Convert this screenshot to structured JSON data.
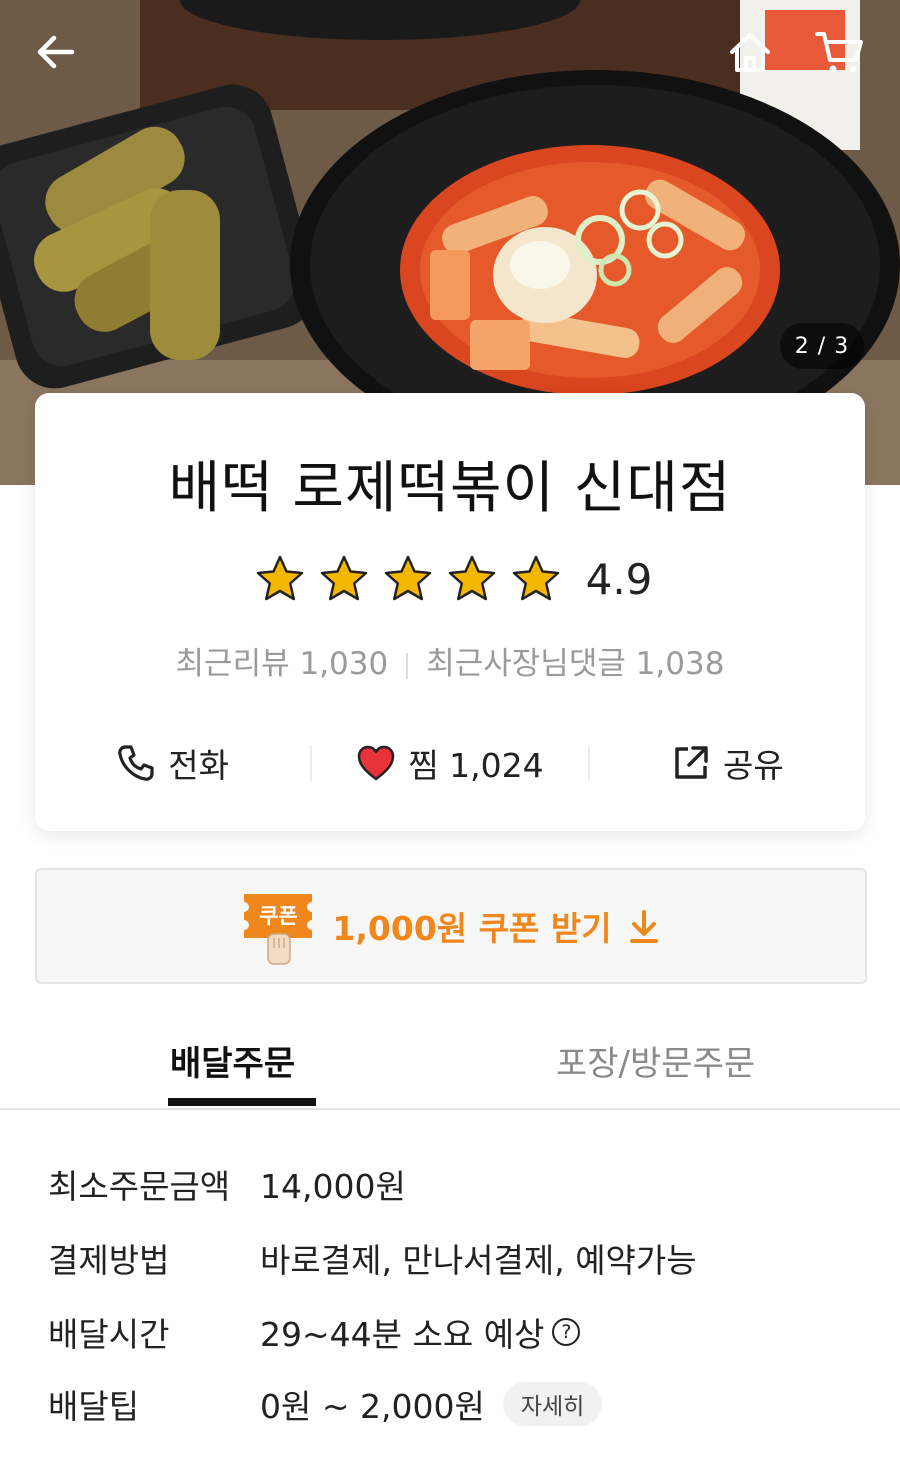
{
  "header": {
    "photo_counter": "2 / 3",
    "icons": [
      "back-arrow-icon",
      "home-icon",
      "cart-icon"
    ]
  },
  "store": {
    "name": "배떡 로제떡볶이 신대점",
    "rating": "4.9",
    "stars_filled": 5,
    "review_label": "최근리뷰 1,030",
    "owner_reply_label": "최근사장님댓글 1,038"
  },
  "actions": {
    "call": "전화",
    "like": "찜 1,024",
    "share": "공유"
  },
  "coupon": {
    "badge": "쿠폰",
    "text": "1,000원 쿠폰 받기"
  },
  "tabs": {
    "delivery": "배달주문",
    "pickup": "포장/방문주문"
  },
  "info": {
    "min_order_label": "최소주문금액",
    "min_order_value": "14,000원",
    "payment_label": "결제방법",
    "payment_value": "바로결제, 만나서결제, 예약가능",
    "time_label": "배달시간",
    "time_value": "29~44분 소요 예상",
    "tip_label": "배달팁",
    "tip_value": "0원 ~ 2,000원",
    "detail_button": "자세히"
  },
  "colors": {
    "accent_orange": "#f0871d",
    "heart_red": "#e8333a",
    "star_gold": "#f5b800"
  }
}
